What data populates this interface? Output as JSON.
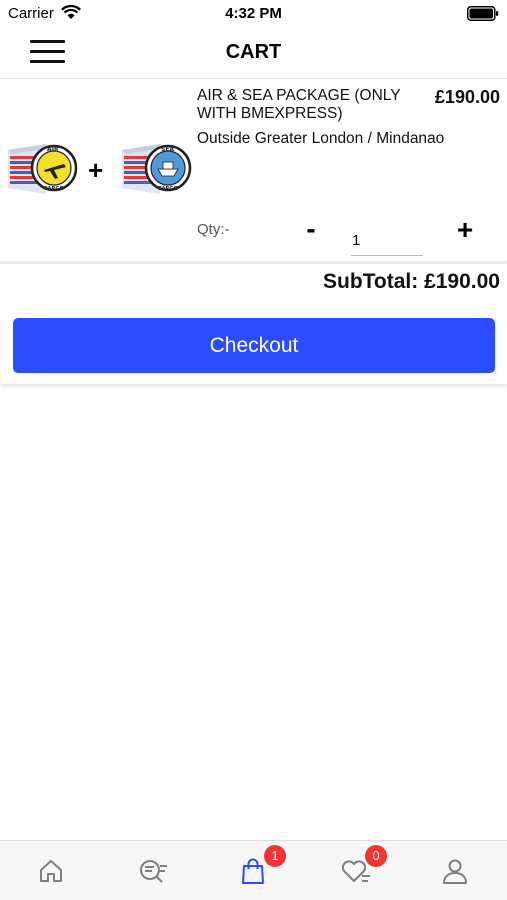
{
  "status_bar": {
    "carrier": "Carrier",
    "time": "4:32 PM"
  },
  "nav": {
    "title": "CART",
    "menu_icon": "hamburger-menu-icon"
  },
  "cart": {
    "items": [
      {
        "name": "AIR & SEA PACKAGE (ONLY WITH BMEXPRESS)",
        "price": "£190.00",
        "variant": "Outside Greater London / Mindanao",
        "qty_label": "Qty:-",
        "quantity": "1",
        "images": [
          "air-cargo-box-image",
          "sea-cargo-box-image"
        ],
        "plus_sign": "+"
      }
    ],
    "qty_minus": "-",
    "qty_plus": "+"
  },
  "summary": {
    "subtotal": "SubTotal: £190.00",
    "checkout_label": "Checkout",
    "accent_color": "#2b4dff"
  },
  "tab_bar": {
    "tabs": [
      {
        "icon": "home-icon",
        "badge": ""
      },
      {
        "icon": "search-list-icon",
        "badge": ""
      },
      {
        "icon": "shopping-bag-icon",
        "badge": "1",
        "active": true
      },
      {
        "icon": "wishlist-heart-icon",
        "badge": "0"
      },
      {
        "icon": "profile-icon",
        "badge": ""
      }
    ],
    "badge_color": "#f03535",
    "active_color": "#2b4dff"
  }
}
